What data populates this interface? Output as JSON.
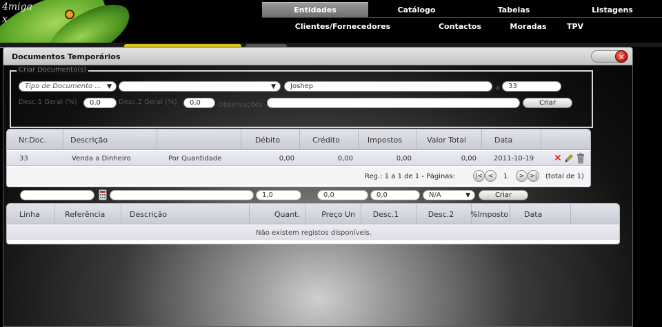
{
  "brand": {
    "logo_line1": "4miga",
    "logo_line2": "x"
  },
  "nav": {
    "top": [
      "Entidades",
      "Catálogo",
      "Tabelas",
      "Listagens"
    ],
    "sub": [
      "Clientes/Fornecedores",
      "Contactos",
      "Moradas",
      "TPV"
    ]
  },
  "window": {
    "title": "Documentos Temporários",
    "close": "×"
  },
  "create": {
    "legend": "Criar Documento(s)",
    "doc_type_placeholder": "Tipo de Documento ...",
    "second_select": "",
    "entity_name": "Joshep",
    "hash_label": "#",
    "doc_number": "33",
    "desc1_label": "Desc.1 Geral (%)",
    "desc1_value": "0,0",
    "desc2_label": "Desc.2 Geral (%)",
    "desc2_value": "0,0",
    "obs_label": "Observações",
    "obs_value": "",
    "create_button": "Criar"
  },
  "documents_grid": {
    "headers": [
      "Nr.Doc.",
      "Descrição",
      "",
      "Débito",
      "Crédito",
      "Impostos",
      "Valor Total",
      "Data",
      ""
    ],
    "rows": [
      {
        "nr": "33",
        "descricao": "Venda a Dinheiro",
        "tipo": "Por Quantidade",
        "debito": "0,00",
        "credito": "0,00",
        "impostos": "0,00",
        "valor_total": "0,00",
        "data": "2011-10-19"
      }
    ],
    "pager": {
      "info": "Reg.: 1 a 1 de 1 - Páginas:",
      "page": "1",
      "total": "(total de 1)",
      "first": "|<",
      "prev": "<",
      "next": ">",
      "last": ">|"
    }
  },
  "line_entry": {
    "ref_value": "",
    "desc_value": "",
    "qty_value": "1,0",
    "price_value": "0,0",
    "disc_value": "0,0",
    "tax_select": "N/A",
    "create_button": "Criar"
  },
  "lines_grid": {
    "headers": [
      "Linha",
      "Referência",
      "Descrição",
      "Quant.",
      "Preço Un",
      "Desc.1",
      "Desc.2",
      "%Imposto",
      "Data",
      ""
    ],
    "empty_text": "Não existem registos disponíveis."
  },
  "colors": {
    "accent_active_tab": "#808080",
    "close_red": "#d42010",
    "grid_header": "#c9cbd5"
  },
  "icons": [
    "delete-icon",
    "edit-pencil-icon",
    "trash-icon",
    "calculator-icon",
    "close-icon",
    "chevron-down-icon"
  ]
}
